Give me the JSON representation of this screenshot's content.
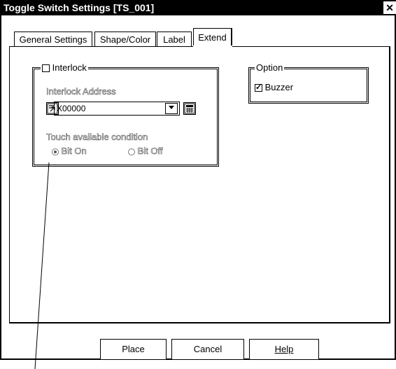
{
  "window": {
    "title": "Toggle Switch Settings [TS_001]",
    "close_glyph": "✕"
  },
  "tabs": [
    {
      "label": "General Settings",
      "active": false
    },
    {
      "label": "Shape/Color",
      "active": false
    },
    {
      "label": "Label",
      "active": false
    },
    {
      "label": "Extend",
      "active": true
    }
  ],
  "interlock": {
    "label": "Interlock",
    "checked": false,
    "address_label": "Interlock Address",
    "address_value": "X00000",
    "touch_condition_label": "Touch available condition",
    "options": [
      {
        "label": "Bit On",
        "selected": true
      },
      {
        "label": "Bit Off",
        "selected": false
      }
    ]
  },
  "option": {
    "group_label": "Option",
    "buzzer_label": "Buzzer",
    "buzzer_checked": true
  },
  "buttons": {
    "place": "Place",
    "cancel": "Cancel",
    "help": "Help"
  },
  "icons": {
    "address_input_icon": "address-input-icon",
    "dropdown_icon": "chevron-down-icon",
    "keypad_icon": "keypad-icon"
  }
}
